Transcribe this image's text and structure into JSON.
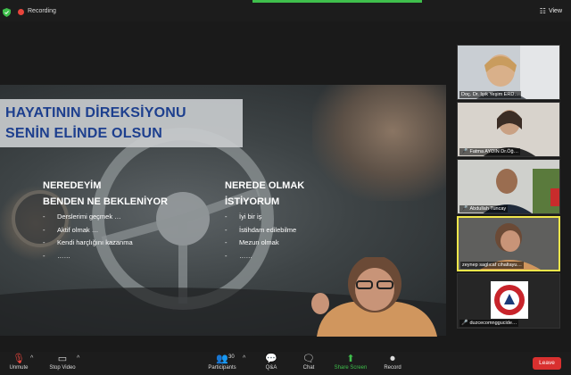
{
  "topbar": {
    "recording_label": "Recording",
    "view_label": "View"
  },
  "slide": {
    "title_line1": "HAYATININ DİREKSİYONU",
    "title_line2": "SENİN ELİNDE OLSUN",
    "left_heading_line1": "NEREDEYİM",
    "left_heading_line2": "BENDEN NE BEKLENİYOR",
    "left_items": [
      "Derslerimi geçmek …",
      "Aktif olmak …",
      "Kendi harçlığını kazanma",
      "……"
    ],
    "right_heading_line1": "NEREDE OLMAK",
    "right_heading_line2": "İSTİYORUM",
    "right_items": [
      "İyi bir iş",
      "İstihdam edilebilme",
      "Mezun olmak",
      "……"
    ]
  },
  "gallery": {
    "participants": [
      {
        "name": "Doç. Dr. Işık Yeşim ERD…",
        "muted": false
      },
      {
        "name": "Fatma AYDIN  Dr.Öğ…",
        "muted": true
      },
      {
        "name": "Abdullah Tuncay",
        "muted": true
      },
      {
        "name": "zeynep saglıcaf cihaltayu…",
        "muted": false
      },
      {
        "name": "duzcecomnggucide…",
        "muted": true
      }
    ]
  },
  "toolbar": {
    "unmute_label": "Unmute",
    "stop_video_label": "Stop Video",
    "participants_label": "Participants",
    "participants_count": "30",
    "qa_label": "Q&A",
    "chat_label": "Chat",
    "share_screen_label": "Share Screen",
    "record_label": "Record",
    "leave_label": "Leave"
  },
  "colors": {
    "accent_green": "#3fbf4c",
    "leave_red": "#d9302f",
    "title_blue": "#1d3f8e",
    "active_border": "#f0e64a"
  }
}
